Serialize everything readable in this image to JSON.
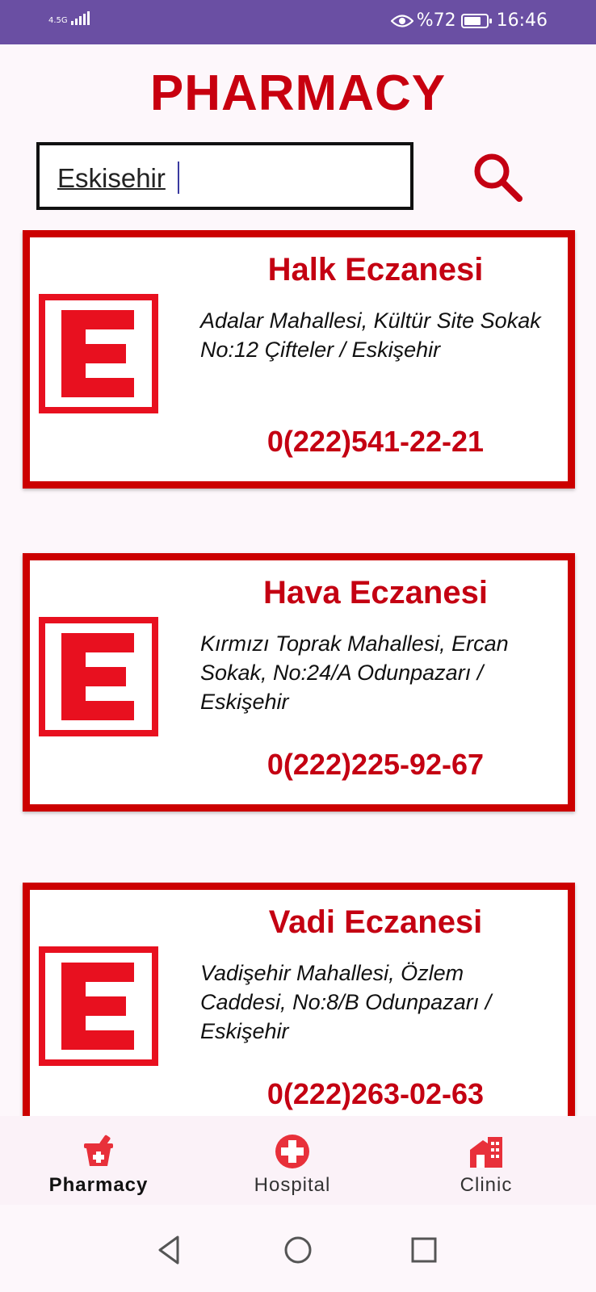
{
  "status_bar": {
    "network": "4.5G",
    "battery": "%72",
    "battery_level": 0.72,
    "time": "16:46"
  },
  "header": {
    "title": "PHARMACY"
  },
  "search": {
    "value": "Eskisehir"
  },
  "pharmacies": [
    {
      "name": "Halk Eczanesi",
      "address": "Adalar Mahallesi, Kültür Site Sokak No:12 Çifteler / Eskişehir",
      "phone": "0(222)541-22-21"
    },
    {
      "name": "Hava Eczanesi",
      "address": "Kırmızı Toprak Mahallesi, Ercan Sokak, No:24/A Odunpazarı / Eskişehir",
      "phone": "0(222)225-92-67"
    },
    {
      "name": "Vadi Eczanesi",
      "address": "Vadişehir Mahallesi, Özlem Caddesi, No:8/B Odunpazarı / Eskişehir",
      "phone": "0(222)263-02-63"
    }
  ],
  "bottom_nav": {
    "items": [
      {
        "label": "Pharmacy",
        "icon": "pharmacy-mortar-icon",
        "active": true
      },
      {
        "label": "Hospital",
        "icon": "hospital-cross-icon",
        "active": false
      },
      {
        "label": "Clinic",
        "icon": "clinic-building-icon",
        "active": false
      }
    ]
  },
  "colors": {
    "accent": "#c8000f",
    "status_bar": "#6a4fa3",
    "logo_red": "#e8101f"
  }
}
